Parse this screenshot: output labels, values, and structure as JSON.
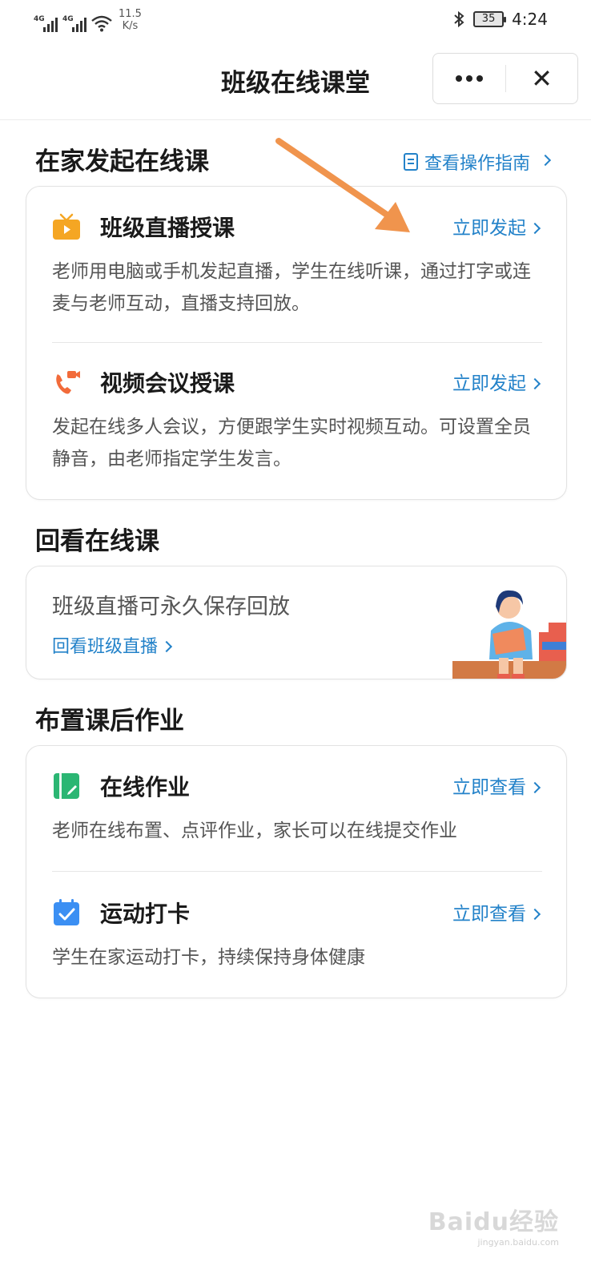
{
  "status_bar": {
    "network1": "4G",
    "network2": "4G",
    "speed_value": "11.5",
    "speed_unit": "K/s",
    "battery": "35",
    "time": "4:24"
  },
  "header": {
    "title": "班级在线课堂",
    "more_icon": "more-dots-icon",
    "close_icon": "close-icon"
  },
  "section_live": {
    "title": "在家发起在线课",
    "guide_link": "查看操作指南",
    "items": [
      {
        "name": "班级直播授课",
        "action": "立即发起",
        "desc": "老师用电脑或手机发起直播，学生在线听课，通过打字或连麦与老师互动，直播支持回放。",
        "icon": "tv-icon",
        "icon_color": "#f5a623"
      },
      {
        "name": "视频会议授课",
        "action": "立即发起",
        "desc": "发起在线多人会议，方便跟学生实时视频互动。可设置全员静音，由老师指定学生发言。",
        "icon": "video-call-icon",
        "icon_color": "#f26b3a"
      }
    ]
  },
  "section_replay": {
    "title": "回看在线课",
    "text": "班级直播可永久保存回放",
    "link": "回看班级直播"
  },
  "section_homework": {
    "title": "布置课后作业",
    "items": [
      {
        "name": "在线作业",
        "action": "立即查看",
        "desc": "老师在线布置、点评作业，家长可以在线提交作业",
        "icon": "homework-icon",
        "icon_color": "#2bb673"
      },
      {
        "name": "运动打卡",
        "action": "立即查看",
        "desc": "学生在家运动打卡，持续保持身体健康",
        "icon": "calendar-check-icon",
        "icon_color": "#3b8ff3"
      }
    ]
  },
  "colors": {
    "link": "#2382c9",
    "annotation_arrow": "#f0944d"
  },
  "watermark": {
    "logo": "Baidu经验",
    "url": "jingyan.baidu.com"
  }
}
